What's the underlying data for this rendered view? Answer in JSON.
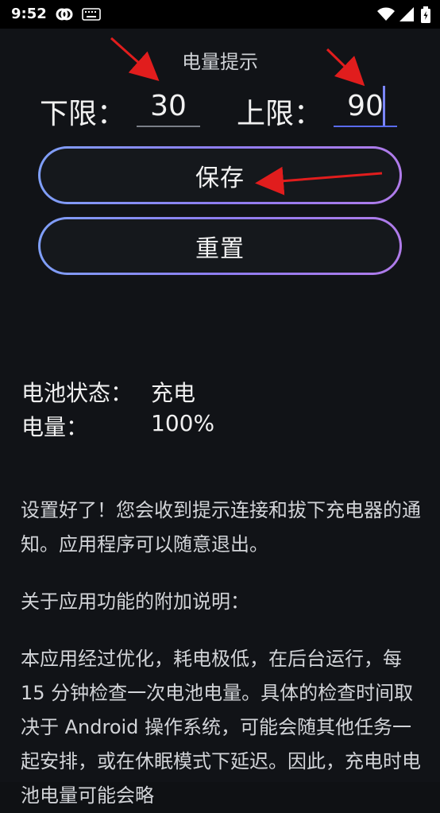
{
  "status_bar": {
    "time": "9:52",
    "left_icons": [
      "link-icon",
      "keyboard-icon"
    ],
    "right_icons": [
      "wifi-icon",
      "signal-icon",
      "battery-charging-icon"
    ]
  },
  "settings": {
    "title": "电量提示",
    "lower_label": "下限：",
    "lower_value": "30",
    "upper_label": "上限：",
    "upper_value": "90",
    "save_label": "保存",
    "reset_label": "重置"
  },
  "battery": {
    "status_label": "电池状态：",
    "status_value": "充电",
    "level_label": "电量：",
    "level_value": "100%"
  },
  "notes": {
    "intro": "设置好了！您会收到提示连接和拔下充电器的通知。应用程序可以随意退出。",
    "heading": "关于应用功能的附加说明：",
    "body": "本应用经过优化，耗电极低，在后台运行，每 15 分钟检查一次电池电量。具体的检查时间取决于 Android 操作系统，可能会随其他任务一起安排，或在休眠模式下延迟。因此，充电时电池电量可能会略"
  },
  "colors": {
    "accent_start": "#7f9ff8",
    "accent_end": "#b07bea",
    "annotation_arrow": "#e11d1d"
  }
}
